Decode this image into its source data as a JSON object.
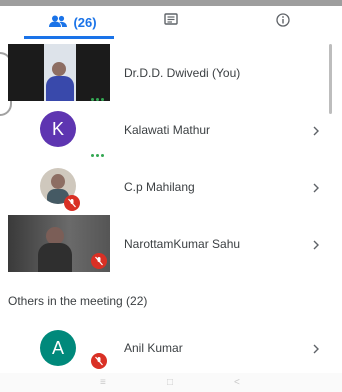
{
  "tabs": {
    "people_count": "(26)",
    "people_icon": "people-icon",
    "chat_icon": "chat-icon",
    "info_icon": "info-icon",
    "accent": "#1a73e8"
  },
  "participants": [
    {
      "name": "Dr.D.D. Dwivedi (You)"
    },
    {
      "name": "Kalawati Mathur",
      "initial": "K",
      "avatar_color": "#5e35b1"
    },
    {
      "name": "C.p Mahilang"
    },
    {
      "name": "NarottamKumar Sahu"
    }
  ],
  "others": {
    "label": "Others in the meeting (22)",
    "items": [
      {
        "name": "Anil Kumar",
        "initial": "A",
        "avatar_color": "#00897b"
      }
    ]
  },
  "nav": {
    "recent": "≡",
    "home": "□",
    "back": "<"
  }
}
